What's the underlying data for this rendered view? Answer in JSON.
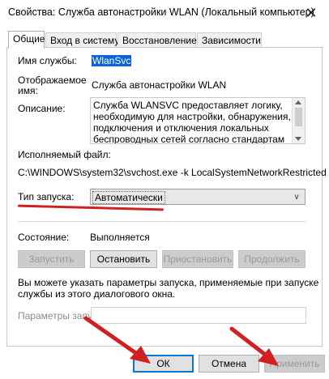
{
  "window": {
    "title": "Свойства: Служба автонастройки WLAN (Локальный компьютер)",
    "close": "✕"
  },
  "tabs": [
    {
      "label": "Общие",
      "active": true
    },
    {
      "label": "Вход в систему",
      "active": false
    },
    {
      "label": "Восстановление",
      "active": false
    },
    {
      "label": "Зависимости",
      "active": false
    }
  ],
  "general": {
    "service_name_label": "Имя службы:",
    "service_name": "WlanSvc",
    "display_name_label_1": "Отображаемое",
    "display_name_label_2": "имя:",
    "display_name": "Служба автонастройки WLAN",
    "description_label": "Описание:",
    "description_lines": [
      "Служба WLANSVC предоставляет логику,",
      "необходимую для настройки, обнаружения,",
      "подключения и отключения локальных",
      "беспроводных сетей согласно стандартам IEEE"
    ],
    "exe_label": "Исполняемый файл:",
    "exe_path": "C:\\WINDOWS\\system32\\svchost.exe -k LocalSystemNetworkRestricted",
    "startup_type_label": "Тип запуска:",
    "startup_type_value": "Автоматически",
    "status_label": "Состояние:",
    "status_value": "Выполняется",
    "buttons": {
      "start": "Запустить",
      "stop": "Остановить",
      "pause": "Приостановить",
      "resume": "Продолжить"
    },
    "hint_line_1": "Вы можете указать параметры запуска, применяемые при запуске",
    "hint_line_2": "службы из этого диалогового окна.",
    "params_label": "Параметры запуска:",
    "params_value": ""
  },
  "footer": {
    "ok": "ОК",
    "cancel": "Отмена",
    "apply": "Применить"
  },
  "colors": {
    "annotation_red": "#d0201f",
    "selection_blue": "#0a64d8",
    "focus_blue": "#0078d7"
  }
}
